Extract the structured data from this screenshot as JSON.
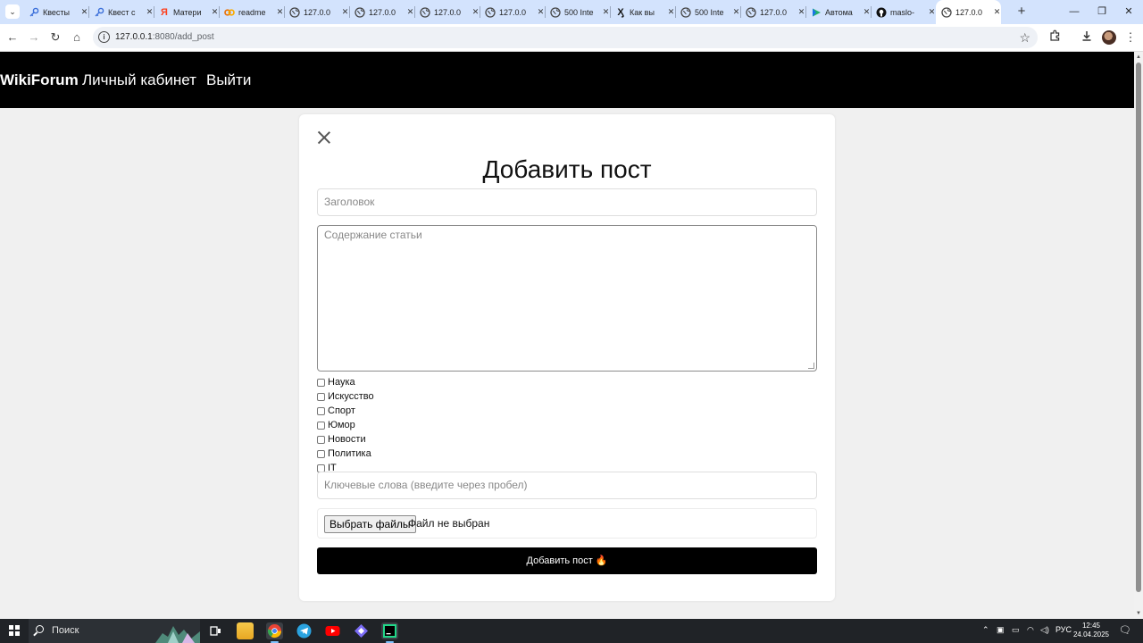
{
  "browser": {
    "tabs": [
      {
        "title": "Квесты",
        "favicon": "key-icon",
        "active": false
      },
      {
        "title": "Квест с",
        "favicon": "key-icon",
        "active": false
      },
      {
        "title": "Матери",
        "favicon": "yandex-icon",
        "active": false
      },
      {
        "title": "readme",
        "favicon": "colab-icon",
        "active": false
      },
      {
        "title": "127.0.0",
        "favicon": "globe-icon",
        "active": false
      },
      {
        "title": "127.0.0",
        "favicon": "globe-icon",
        "active": false
      },
      {
        "title": "127.0.0",
        "favicon": "globe-icon",
        "active": false
      },
      {
        "title": "127.0.0",
        "favicon": "globe-icon",
        "active": false
      },
      {
        "title": "500 Inte",
        "favicon": "globe-icon",
        "active": false
      },
      {
        "title": "Как вы",
        "favicon": "x-icon",
        "active": false
      },
      {
        "title": "500 Inte",
        "favicon": "globe-icon",
        "active": false
      },
      {
        "title": "127.0.0",
        "favicon": "globe-icon",
        "active": false
      },
      {
        "title": "Автома",
        "favicon": "play-icon",
        "active": false
      },
      {
        "title": "maslo-",
        "favicon": "github-icon",
        "active": false
      },
      {
        "title": "127.0.0",
        "favicon": "globe-icon",
        "active": true
      }
    ],
    "url_host": "127.0.0.1",
    "url_path": ":8080/add_post"
  },
  "navbar": {
    "brand": "WikiForum",
    "links": [
      "Личный кабинет",
      "Выйти"
    ]
  },
  "form": {
    "title": "Добавить пост",
    "title_placeholder": "Заголовок",
    "content_placeholder": "Содержание статьи",
    "categories": [
      "Наука",
      "Искусство",
      "Спорт",
      "Юмор",
      "Новости",
      "Политика",
      "IT"
    ],
    "keywords_placeholder": "Ключевые слова (введите через пробел)",
    "file_button": "Выбрать файлы",
    "file_status": "Файл не выбран",
    "submit_label": "Добавить пост",
    "submit_emoji": "🔥"
  },
  "taskbar": {
    "search_label": "Поиск",
    "language": "РУС",
    "time": "12:45",
    "date": "24.04.2025"
  },
  "colors": {
    "navbar_bg": "#000000",
    "page_bg": "#f0f0f0",
    "tabstrip_bg": "#d3e3fd",
    "submit_bg": "#000000"
  }
}
